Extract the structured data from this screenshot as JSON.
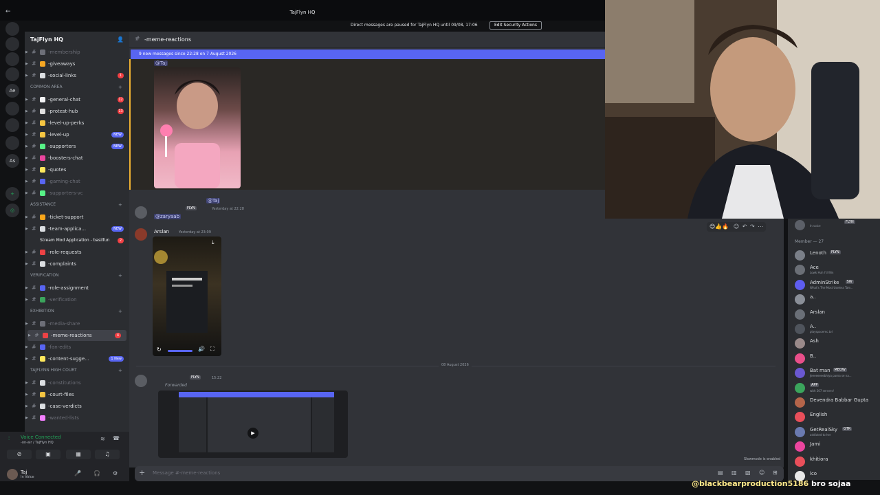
{
  "window": {
    "title": "TajFlyn HQ",
    "notice": "Direct messages are paused for TajFlyn HQ until 09/08, 17:06",
    "notice_button": "Edit Security Actions"
  },
  "rail": {
    "servers": [
      {
        "label": "",
        "badge": "42"
      },
      {
        "label": "",
        "badge": "1"
      },
      {
        "label": "",
        "badge": "1"
      },
      {
        "label": "",
        "badge": "77"
      },
      {
        "label": "Ae",
        "badge": ""
      },
      {
        "label": "",
        "badge": "5"
      },
      {
        "label": "",
        "badge": "1"
      },
      {
        "label": "",
        "badge": "2"
      },
      {
        "label": "As",
        "badge": ""
      }
    ]
  },
  "sidebar": {
    "server_name": "TajFlyn HQ",
    "items": [
      {
        "type": "channel",
        "name": "-membership",
        "muted": true,
        "color": "#6d6f78"
      },
      {
        "type": "channel",
        "name": "-giveaways",
        "color": "#f5a623"
      },
      {
        "type": "channel",
        "name": "-social-links",
        "count": "1",
        "color": "#dbdee1"
      },
      {
        "type": "category",
        "name": "COMMON AREA"
      },
      {
        "type": "channel",
        "name": "-general-chat",
        "count": "12",
        "color": "#f2f3f5"
      },
      {
        "type": "channel",
        "name": "-protest-hub",
        "count": "13",
        "color": "#e0e0e0"
      },
      {
        "type": "channel",
        "name": "-level-up-perks",
        "color": "#f5c542"
      },
      {
        "type": "channel",
        "name": "-level-up",
        "new": "NEW",
        "color": "#f5c542"
      },
      {
        "type": "channel",
        "name": "-supporters",
        "new": "NEW",
        "color": "#57f287"
      },
      {
        "type": "channel",
        "name": "-boosters-chat",
        "color": "#eb459e"
      },
      {
        "type": "channel",
        "name": "-quotes",
        "color": "#fee75c"
      },
      {
        "type": "channel",
        "name": "-gaming-chat",
        "muted": true,
        "color": "#5865f2"
      },
      {
        "type": "channel",
        "name": "-supporters-vc",
        "muted": true,
        "color": "#57f287"
      },
      {
        "type": "category",
        "name": "ASSISTANCE"
      },
      {
        "type": "channel",
        "name": "-ticket-support",
        "color": "#faa61a"
      },
      {
        "type": "channel",
        "name": "-team-applica...",
        "new": "NEW",
        "color": "#dbdee1"
      },
      {
        "type": "thread",
        "name": "Stream Mod Application - basilfun",
        "count": "2"
      },
      {
        "type": "channel",
        "name": "-role-requests",
        "color": "#ed4245"
      },
      {
        "type": "channel",
        "name": "-complaints",
        "color": "#dbdee1"
      },
      {
        "type": "category",
        "name": "Verification"
      },
      {
        "type": "channel",
        "name": "-role-assignment",
        "color": "#5865f2"
      },
      {
        "type": "channel",
        "name": "-verification",
        "muted": true,
        "color": "#3ba55c"
      },
      {
        "type": "category",
        "name": "EXHIBITION"
      },
      {
        "type": "channel",
        "name": "-media-share",
        "muted": true,
        "color": "#6d6f78"
      },
      {
        "type": "channel",
        "name": "-meme-reactions",
        "count": "4",
        "active": true,
        "color": "#ed4245"
      },
      {
        "type": "channel",
        "name": "-fan-edits",
        "muted": true,
        "color": "#5865f2"
      },
      {
        "type": "channel",
        "name": "-content-sugge...",
        "new": "1 New",
        "color": "#fee75c"
      },
      {
        "type": "category",
        "name": "TAJFLYNN HIGH COURT"
      },
      {
        "type": "channel",
        "name": "-constitutions",
        "muted": true,
        "color": "#dbdee1"
      },
      {
        "type": "channel",
        "name": "-court-files",
        "color": "#f5c542"
      },
      {
        "type": "channel",
        "name": "-case-verdicts",
        "color": "#dbdee1"
      },
      {
        "type": "channel",
        "name": "-wanted-lists",
        "muted": true,
        "color": "#f47fff"
      }
    ]
  },
  "voice": {
    "status": "Voice Connected",
    "channel": "-on-air / TajFlyn HQ"
  },
  "user": {
    "name": "Taj",
    "status": "In Voice"
  },
  "chat": {
    "channel_name": "-meme-reactions",
    "new_messages": "9 new messages since 22:28 on 7 August 2026",
    "reply_mention": "@Taj",
    "msg1_tag": "FLYN",
    "msg1_time": "Yesterday at 22:28",
    "msg1_reply_mention": "@Taj",
    "msg1_mention": "@zaryaab",
    "msg2_author": "Arslan",
    "msg2_time": "Yesterday at 23:09",
    "day_divider": "08 August 2026",
    "msg3_tag": "FLYN",
    "msg3_time": "15:22",
    "forwarded": "Forwarded",
    "composer_placeholder": "Message #-meme-reactions",
    "slowmode": "Slowmode is enabled",
    "reactions": "😍👍🔥"
  },
  "members": {
    "top_status": "In voice",
    "top_tag": "FLYN",
    "header": "Member — 27",
    "list": [
      {
        "name": "Lenoth",
        "status": "",
        "tag": "FLYN"
      },
      {
        "name": "Ace",
        "status": "Lowk Huh I'd Win",
        "tag": ""
      },
      {
        "name": "AdminStrike",
        "status": "What's The Most Useless Tale...",
        "tag": "SW"
      },
      {
        "name": "a..",
        "status": "",
        "tag": ""
      },
      {
        "name": "Arslan",
        "status": "",
        "tag": ""
      },
      {
        "name": "A..",
        "status": "playspacemc.tol",
        "tag": ""
      },
      {
        "name": "Ash",
        "status": "",
        "tag": ""
      },
      {
        "name": "B..",
        "status": "",
        "tag": ""
      },
      {
        "name": "Bat man",
        "status": "Jeeeeeeeebhiya parna se na...",
        "tag": "MEOW"
      },
      {
        "name": "",
        "status": "with 207 servers!",
        "tag": "APP"
      },
      {
        "name": "Devendra Babbar Gupta",
        "status": "",
        "tag": ""
      },
      {
        "name": "English",
        "status": "",
        "tag": ""
      },
      {
        "name": "GetRealSky",
        "status": "addicted to her",
        "tag": "GTR"
      },
      {
        "name": "Jami",
        "status": "",
        "tag": ""
      },
      {
        "name": "khitiora",
        "status": "",
        "tag": ""
      },
      {
        "name": "lco",
        "status": "",
        "tag": ""
      }
    ]
  },
  "overlay": {
    "handle": "@blackbearproduction5186",
    "message": "bro sojaa"
  },
  "colors": {
    "accent": "#5865f2",
    "danger": "#f23f43",
    "online": "#23a559",
    "highlight": "#f0b232"
  }
}
